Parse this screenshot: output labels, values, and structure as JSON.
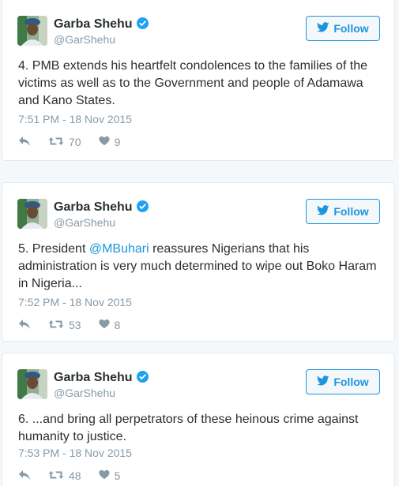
{
  "colors": {
    "link": "#1b95e0",
    "meta": "#8899a6",
    "text": "#292f33",
    "verified": "#1da1f2"
  },
  "tweets": [
    {
      "author": "Garba Shehu",
      "handle": "@GarShehu",
      "follow_label": "Follow",
      "text_before": "4. PMB extends his heartfelt condolences to the families of the victims as well as to the Government and people of Adamawa and Kano States.",
      "mention": "",
      "text_after": "",
      "timestamp": "7:51 PM - 18 Nov 2015",
      "retweets": "70",
      "likes": "9"
    },
    {
      "author": "Garba Shehu",
      "handle": "@GarShehu",
      "follow_label": "Follow",
      "text_before": "5. President ",
      "mention": "@MBuhari",
      "text_after": " reassures Nigerians that his administration is very much determined to wipe out Boko Haram in Nigeria...",
      "timestamp": "7:52 PM - 18 Nov 2015",
      "retweets": "53",
      "likes": "8"
    },
    {
      "author": "Garba Shehu",
      "handle": "@GarShehu",
      "follow_label": "Follow",
      "text_before": "6. ...and bring all perpetrators of these heinous crime against humanity to justice.",
      "mention": "",
      "text_after": "",
      "timestamp": "7:53 PM - 18 Nov 2015",
      "retweets": "48",
      "likes": "5"
    }
  ]
}
